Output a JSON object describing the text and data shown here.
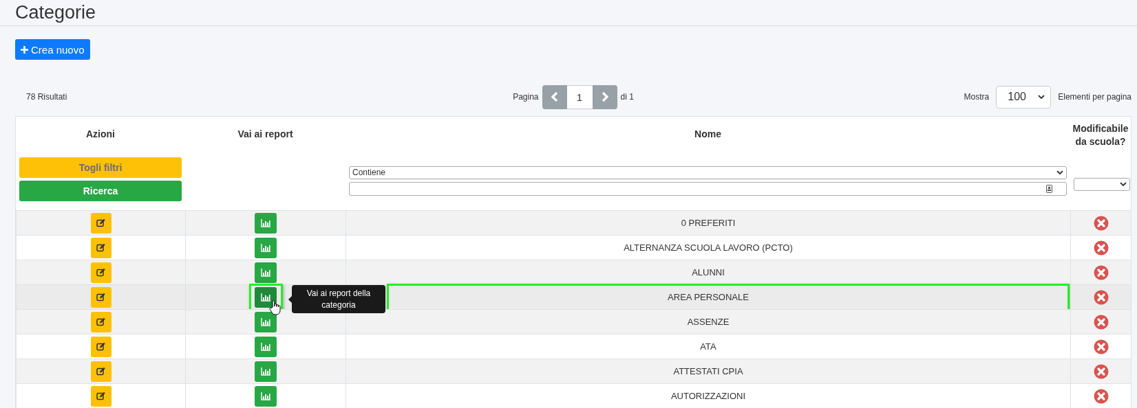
{
  "page": {
    "title": "Categorie"
  },
  "create_button": {
    "label": "Crea nuovo"
  },
  "results": "78 Risultati",
  "pagination": {
    "label": "Pagina",
    "page": "1",
    "of": "di 1"
  },
  "page_size": {
    "label": "Mostra",
    "value": "100",
    "suffix": "Elementi per pagina"
  },
  "table": {
    "columns": [
      "Azioni",
      "Vai ai report",
      "Nome",
      "Modificabile da scuola?"
    ],
    "filters": {
      "clear_button": "Togli filtri",
      "search_button": "Ricerca",
      "name_mode": "Contiene"
    },
    "rows": [
      {
        "name": "0 PREFERITI",
        "modifiable": false,
        "hovered": false,
        "annotated": false
      },
      {
        "name": "ALTERNANZA SCUOLA LAVORO (PCTO)",
        "modifiable": false,
        "hovered": false,
        "annotated": false
      },
      {
        "name": "ALUNNI",
        "modifiable": false,
        "hovered": false,
        "annotated": false
      },
      {
        "name": "AREA PERSONALE",
        "modifiable": false,
        "hovered": true,
        "annotated": true,
        "tooltip": "Vai ai report della categoria"
      },
      {
        "name": "ASSENZE",
        "modifiable": false,
        "hovered": false,
        "annotated": false
      },
      {
        "name": "ATA",
        "modifiable": false,
        "hovered": false,
        "annotated": false
      },
      {
        "name": "ATTESTATI CPIA",
        "modifiable": false,
        "hovered": false,
        "annotated": false
      },
      {
        "name": "AUTORIZZAZIONI",
        "modifiable": false,
        "hovered": false,
        "annotated": false
      }
    ]
  }
}
